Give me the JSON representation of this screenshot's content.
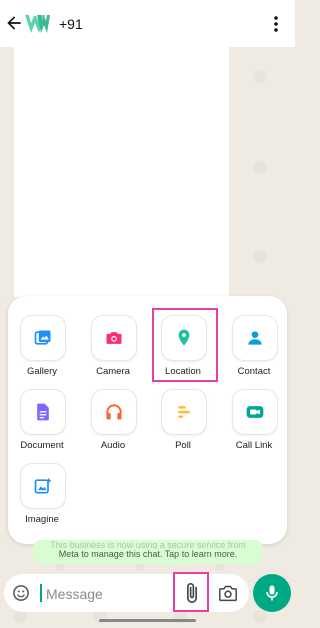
{
  "header": {
    "contact_name": "+91"
  },
  "attach_menu": {
    "items": [
      {
        "label": "Gallery",
        "icon": "gallery-icon",
        "color": "#1d8ffb"
      },
      {
        "label": "Camera",
        "icon": "camera-icon",
        "color": "#ff2e74"
      },
      {
        "label": "Location",
        "icon": "location-icon",
        "color": "#1fc29a"
      },
      {
        "label": "Contact",
        "icon": "contact-icon",
        "color": "#0a9de2"
      },
      {
        "label": "Document",
        "icon": "document-icon",
        "color": "#7f66ff"
      },
      {
        "label": "Audio",
        "icon": "headphones-icon",
        "color": "#fa6533"
      },
      {
        "label": "Poll",
        "icon": "poll-icon",
        "color": "#ffbc38"
      },
      {
        "label": "Call Link",
        "icon": "call-link-icon",
        "color": "#02a698"
      },
      {
        "label": "Imagine",
        "icon": "imagine-icon",
        "color": "#1d8ffb"
      }
    ]
  },
  "banner": {
    "line1": "This business is now using a secure service from",
    "line2": "Meta to manage this chat. Tap to learn more."
  },
  "composer": {
    "placeholder": "Message"
  },
  "colors": {
    "accent": "#00a884",
    "highlight": "#e83ea8"
  }
}
